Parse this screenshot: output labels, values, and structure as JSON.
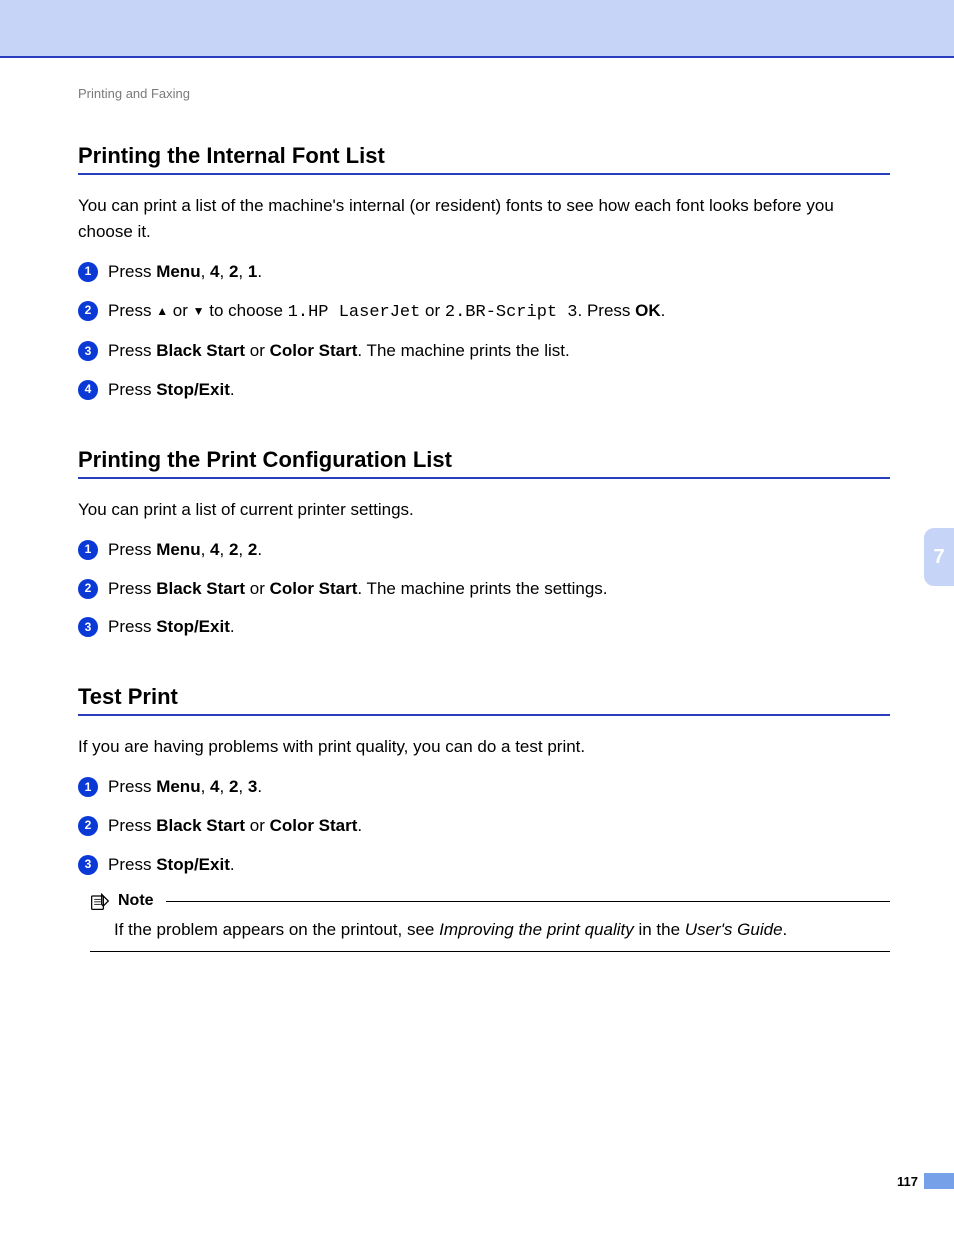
{
  "breadcrumb": "Printing and Faxing",
  "sideTab": "7",
  "pageNumber": "117",
  "sections": [
    {
      "title": "Printing the Internal Font List",
      "intro": "You can print a list of the machine's internal (or resident) fonts to see how each font looks before you choose it.",
      "steps": [
        {
          "num": "1",
          "html": "Press <b>Menu</b>, <b>4</b>, <b>2</b>, <b>1</b>."
        },
        {
          "num": "2",
          "html": "Press <span class='arrow'>▲</span> or <span class='arrow'>▼</span> to choose <span class='mono'>1.HP LaserJet</span> or <span class='mono'>2.BR-Script 3</span>. Press <b>OK</b>."
        },
        {
          "num": "3",
          "html": "Press <b>Black Start</b> or <b>Color Start</b>. The machine prints the list."
        },
        {
          "num": "4",
          "html": "Press <b>Stop/Exit</b>."
        }
      ]
    },
    {
      "title": "Printing the Print Configuration List",
      "intro": "You can print a list of current printer settings.",
      "steps": [
        {
          "num": "1",
          "html": "Press <b>Menu</b>, <b>4</b>, <b>2</b>, <b>2</b>."
        },
        {
          "num": "2",
          "html": "Press <b>Black Start</b> or <b>Color Start</b>. The machine prints the settings."
        },
        {
          "num": "3",
          "html": "Press <b>Stop/Exit</b>."
        }
      ]
    },
    {
      "title": "Test Print",
      "intro": "If you are having problems with print quality, you can do a test print.",
      "steps": [
        {
          "num": "1",
          "html": "Press <b>Menu</b>, <b>4</b>, <b>2</b>, <b>3</b>."
        },
        {
          "num": "2",
          "html": "Press <b>Black Start</b> or <b>Color Start</b>."
        },
        {
          "num": "3",
          "html": "Press <b>Stop/Exit</b>."
        }
      ],
      "note": {
        "label": "Note",
        "html": "If the problem appears on the printout, see <i>Improving the print quality</i> in the <i>User's Guide</i>."
      }
    }
  ]
}
